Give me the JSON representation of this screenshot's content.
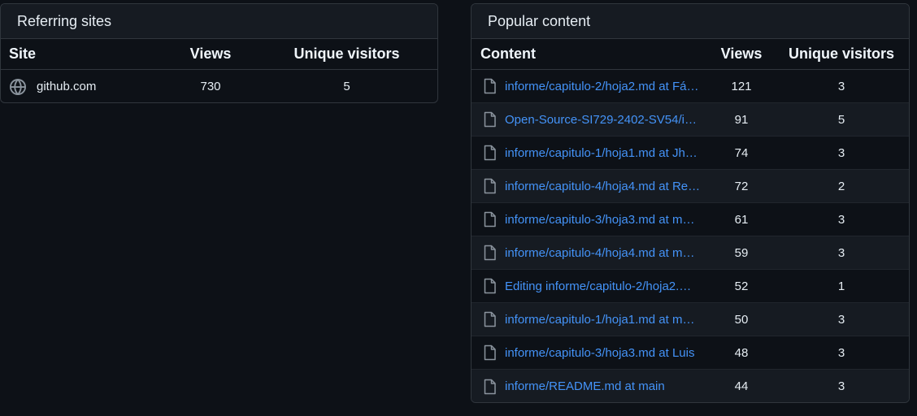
{
  "referring": {
    "title": "Referring sites",
    "headers": {
      "site": "Site",
      "views": "Views",
      "unique": "Unique visitors"
    },
    "rows": [
      {
        "site": "github.com",
        "views": "730",
        "unique": "5",
        "icon": "globe-icon"
      }
    ]
  },
  "popular": {
    "title": "Popular content",
    "headers": {
      "content": "Content",
      "views": "Views",
      "unique": "Unique visitors"
    },
    "rows": [
      {
        "content": "informe/capitulo-2/hoja2.md at Fá…",
        "views": "121",
        "unique": "3",
        "icon": "file-icon"
      },
      {
        "content": "Open-Source-SI729-2402-SV54/inf…",
        "views": "91",
        "unique": "5",
        "icon": "file-icon"
      },
      {
        "content": "informe/capitulo-1/hoja1.md at Jh…",
        "views": "74",
        "unique": "3",
        "icon": "file-icon"
      },
      {
        "content": "informe/capitulo-4/hoja4.md at Re…",
        "views": "72",
        "unique": "2",
        "icon": "file-icon"
      },
      {
        "content": "informe/capitulo-3/hoja3.md at m…",
        "views": "61",
        "unique": "3",
        "icon": "file-icon"
      },
      {
        "content": "informe/capitulo-4/hoja4.md at m…",
        "views": "59",
        "unique": "3",
        "icon": "file-icon"
      },
      {
        "content": "Editing informe/capitulo-2/hoja2.…",
        "views": "52",
        "unique": "1",
        "icon": "file-icon"
      },
      {
        "content": "informe/capitulo-1/hoja1.md at m…",
        "views": "50",
        "unique": "3",
        "icon": "file-icon"
      },
      {
        "content": "informe/capitulo-3/hoja3.md at Luis",
        "views": "48",
        "unique": "3",
        "icon": "file-icon"
      },
      {
        "content": "informe/README.md at main",
        "views": "44",
        "unique": "3",
        "icon": "file-icon"
      }
    ]
  },
  "colors": {
    "background": "#0d1117",
    "link": "#4493f8",
    "border": "#30363d",
    "header_bg": "#161b22"
  }
}
